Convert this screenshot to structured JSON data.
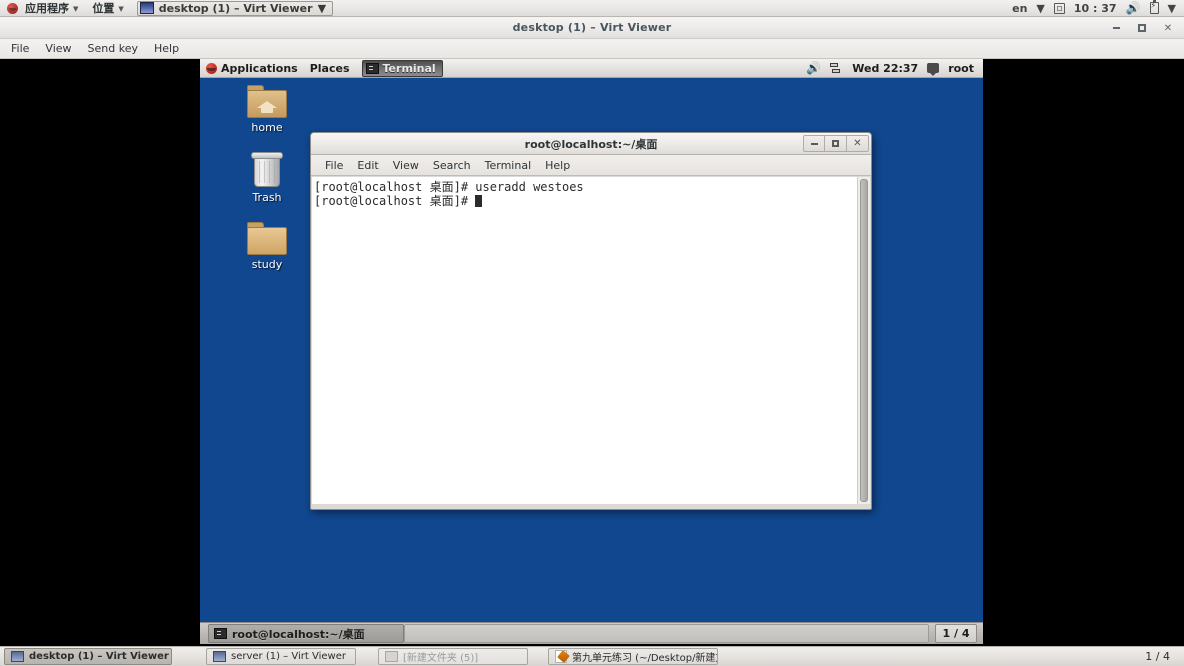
{
  "os_panel": {
    "applications_label": "应用程序",
    "places_label": "位置",
    "window_button_label": "desktop (1) – Virt Viewer",
    "keyboard_layout": "en",
    "clock": "10 : 37"
  },
  "virt_viewer": {
    "title": "desktop (1) – Virt Viewer",
    "menus": [
      "File",
      "View",
      "Send key",
      "Help"
    ],
    "window_controls": [
      "minimize",
      "maximize",
      "close"
    ]
  },
  "guest": {
    "top_panel": {
      "applications_label": "Applications",
      "places_label": "Places",
      "window_list_item": "Terminal",
      "clock": "Wed 22:37",
      "user": "root"
    },
    "desktop_icons": [
      {
        "name": "home",
        "label": "home",
        "icon": "home-folder-icon"
      },
      {
        "name": "trash",
        "label": "Trash",
        "icon": "trash-can-icon"
      },
      {
        "name": "study",
        "label": "study",
        "icon": "folder-icon"
      }
    ],
    "terminal": {
      "title": "root@localhost:~/桌面",
      "menus": [
        "File",
        "Edit",
        "View",
        "Search",
        "Terminal",
        "Help"
      ],
      "lines": [
        "[root@localhost 桌面]# useradd westoes",
        "[root@localhost 桌面]# "
      ]
    },
    "bottom_panel": {
      "task_label": "root@localhost:~/桌面",
      "workspace_indicator": "1 / 4"
    }
  },
  "taskbar": {
    "items": [
      {
        "label": "desktop (1) – Virt Viewer",
        "icon": "screen-icon",
        "state": "active"
      },
      {
        "label": "server (1) – Virt Viewer",
        "icon": "screen-icon",
        "state": "normal"
      },
      {
        "label": "[新建文件夹 (5)]",
        "icon": "folder-icon",
        "state": "dim"
      },
      {
        "label": "第九单元练习 (~/Desktop/新建文...",
        "icon": "document-icon",
        "state": "normal"
      }
    ],
    "page_indicator": "1 / 4"
  }
}
